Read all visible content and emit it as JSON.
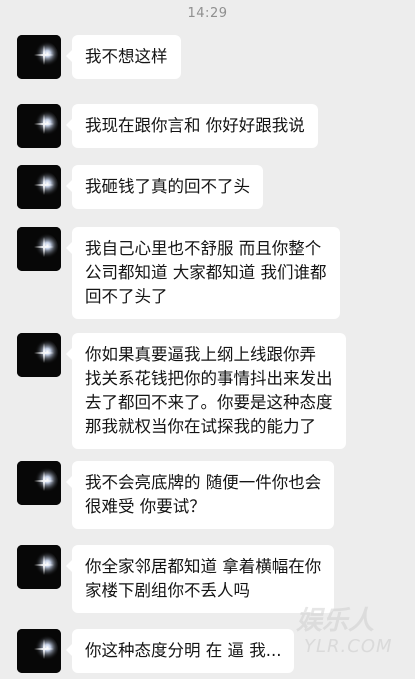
{
  "status_time": "14:29",
  "messages": [
    {
      "lines": [
        "我不想这样"
      ]
    },
    {
      "lines": [
        "我现在跟你言和 你好好跟我说"
      ]
    },
    {
      "lines": [
        "我砸钱了真的回不了头"
      ]
    },
    {
      "lines": [
        "我自己心里也不舒服 而且你整个",
        "公司都知道 大家都知道 我们谁都",
        "回不了头了"
      ]
    },
    {
      "lines": [
        "你如果真要逼我上纲上线跟你弄",
        "找关系花钱把你的事情抖出来发出",
        "去了都回不来了。你要是这种态度",
        "那我就权当你在试探我的能力了"
      ]
    },
    {
      "lines": [
        "我不会亮底牌的 随便一件你也会",
        "很难受 你要试？"
      ]
    },
    {
      "lines": [
        "你全家邻居都知道 拿着横幅在你",
        "家楼下剧组你不丢人吗"
      ]
    },
    {
      "lines": [
        "你这种态度分明 在 逼 我..."
      ]
    }
  ],
  "watermark": {
    "top": "娱乐人",
    "bottom": "YLR.COM"
  },
  "avatar_icon": "sparkle-avatar-icon"
}
